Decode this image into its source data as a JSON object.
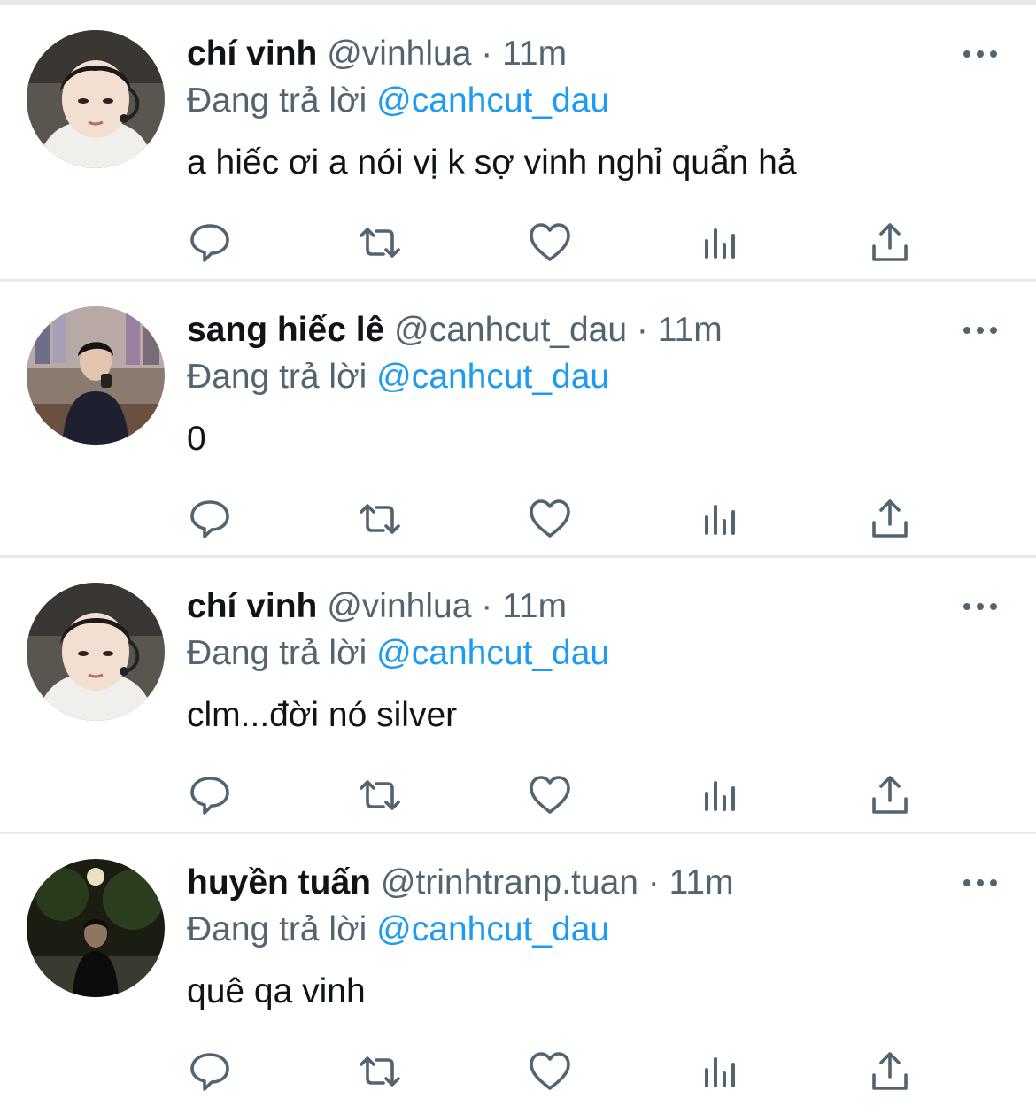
{
  "theme": {
    "text": "#0f1419",
    "secondary": "#536471",
    "mention": "#1d9bf0",
    "divider": "#e7e9ea",
    "icon": "#536471"
  },
  "tweets": [
    {
      "name": "chí vinh",
      "handle": "@vinhlua",
      "dot": "·",
      "time": "11m",
      "reply_prefix": "Đang trả lời",
      "reply_to": "@canhcut_dau",
      "text": "a hiếc ơi a nói vị k sợ vinh nghỉ quẩn hả",
      "avatar": "photo-avatar"
    },
    {
      "name": "sang hiếc lê",
      "handle": "@canhcut_dau",
      "dot": "·",
      "time": "11m",
      "reply_prefix": "Đang trả lời",
      "reply_to": "@canhcut_dau",
      "text": "0",
      "avatar": "photo-avatar"
    },
    {
      "name": "chí vinh",
      "handle": "@vinhlua",
      "dot": "·",
      "time": "11m",
      "reply_prefix": "Đang trả lời",
      "reply_to": "@canhcut_dau",
      "text": "clm...đời nó silver",
      "avatar": "photo-avatar"
    },
    {
      "name": "huyền tuấn",
      "handle": "@trinhtranp.tuan",
      "dot": "·",
      "time": "11m",
      "reply_prefix": "Đang trả lời",
      "reply_to": "@canhcut_dau",
      "text": "quê qa vinh",
      "avatar": "photo-avatar"
    }
  ],
  "action_icons": [
    "reply-icon",
    "retweet-icon",
    "like-icon",
    "analytics-icon",
    "share-icon"
  ],
  "more_icon": "more-icon"
}
